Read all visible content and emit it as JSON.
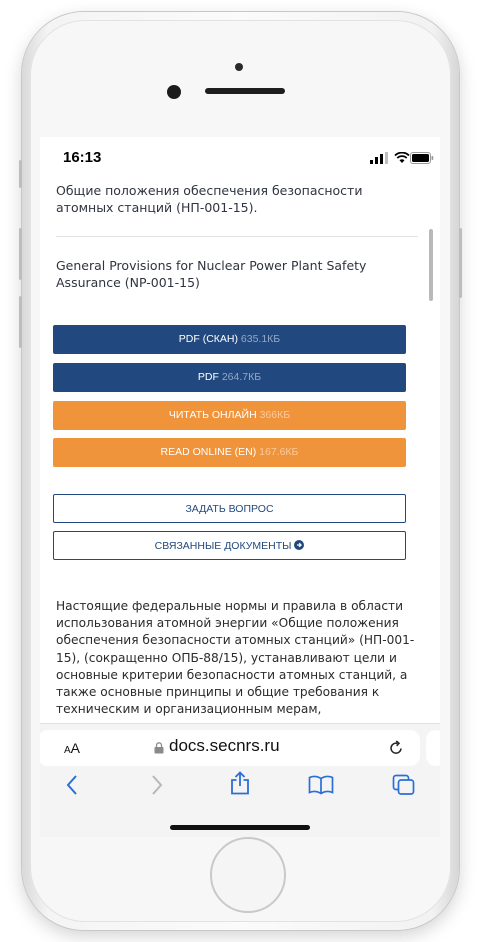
{
  "status_bar": {
    "time": "16:13"
  },
  "document": {
    "title_ru": "Общие положения обеспечения безопасности атомных станций (НП-001-15).",
    "title_en": "General Provisions for Nuclear Power Plant Safety Assurance (NP-001-15)"
  },
  "downloads": [
    {
      "label": "PDF (СКАН)",
      "size": "635.1КБ",
      "color": "#22497f"
    },
    {
      "label": "PDF",
      "size": "264.7КБ",
      "color": "#22497f"
    },
    {
      "label": "ЧИТАТЬ ОНЛАЙН",
      "size": "366КБ",
      "color": "#f0943c"
    },
    {
      "label": "READ ONLINE (EN)",
      "size": "167.6КБ",
      "color": "#f0943c"
    }
  ],
  "actions": {
    "ask_question": "ЗАДАТЬ ВОПРОС",
    "related_documents": "СВЯЗАННЫЕ ДОКУМЕНТЫ"
  },
  "body_text": "Настоящие федеральные нормы и правила в области использования атомной энергии «Общие положения обеспечения безопасности атомных станций» (НП-001-15), (сокращенно ОПБ-88/15), устанавливают цели и основные критерии безопасности атомных станций, а также основные принципы и общие требования к техническим и организационным мерам,",
  "browser": {
    "text_size_label": "AA",
    "domain": "docs.secnrs.ru",
    "icons": [
      "back-icon",
      "forward-icon",
      "share-icon",
      "bookmarks-icon",
      "tabs-icon",
      "reload-icon",
      "lock-icon"
    ]
  }
}
